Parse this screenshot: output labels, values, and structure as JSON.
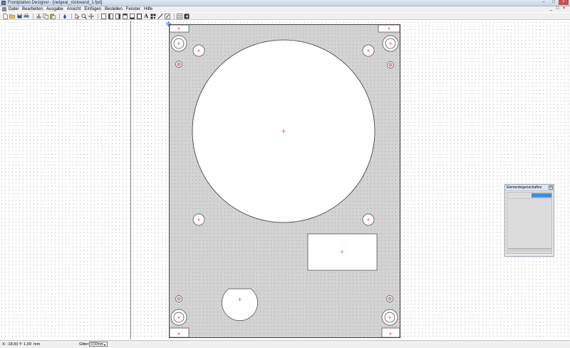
{
  "window": {
    "title": "Frontplatten Designer - [netgear_rückwand_1.fpd]",
    "btn_minimize": "–",
    "btn_maximize": "□",
    "btn_close": "×"
  },
  "menu": {
    "items": [
      "Datei",
      "Bearbeiten",
      "Ausgabe",
      "Ansicht",
      "Einfügen",
      "Bestellen",
      "Fenster",
      "Hilfe"
    ],
    "right": [
      "_",
      "□",
      "×"
    ]
  },
  "toolbar": {
    "text_tool": "A"
  },
  "properties_panel": {
    "title": "Elementeigenschaften",
    "close": "×"
  },
  "status": {
    "coords": "X: -18,50  Y: 1,00",
    "unit": "mm",
    "grid_label": "Gitter",
    "grid_value": "0,50mm"
  },
  "colors": {
    "panel": "#d3d3d3",
    "panel_border": "#444444",
    "center_marker": "#ee2222",
    "selection": "#3c8fe0"
  }
}
